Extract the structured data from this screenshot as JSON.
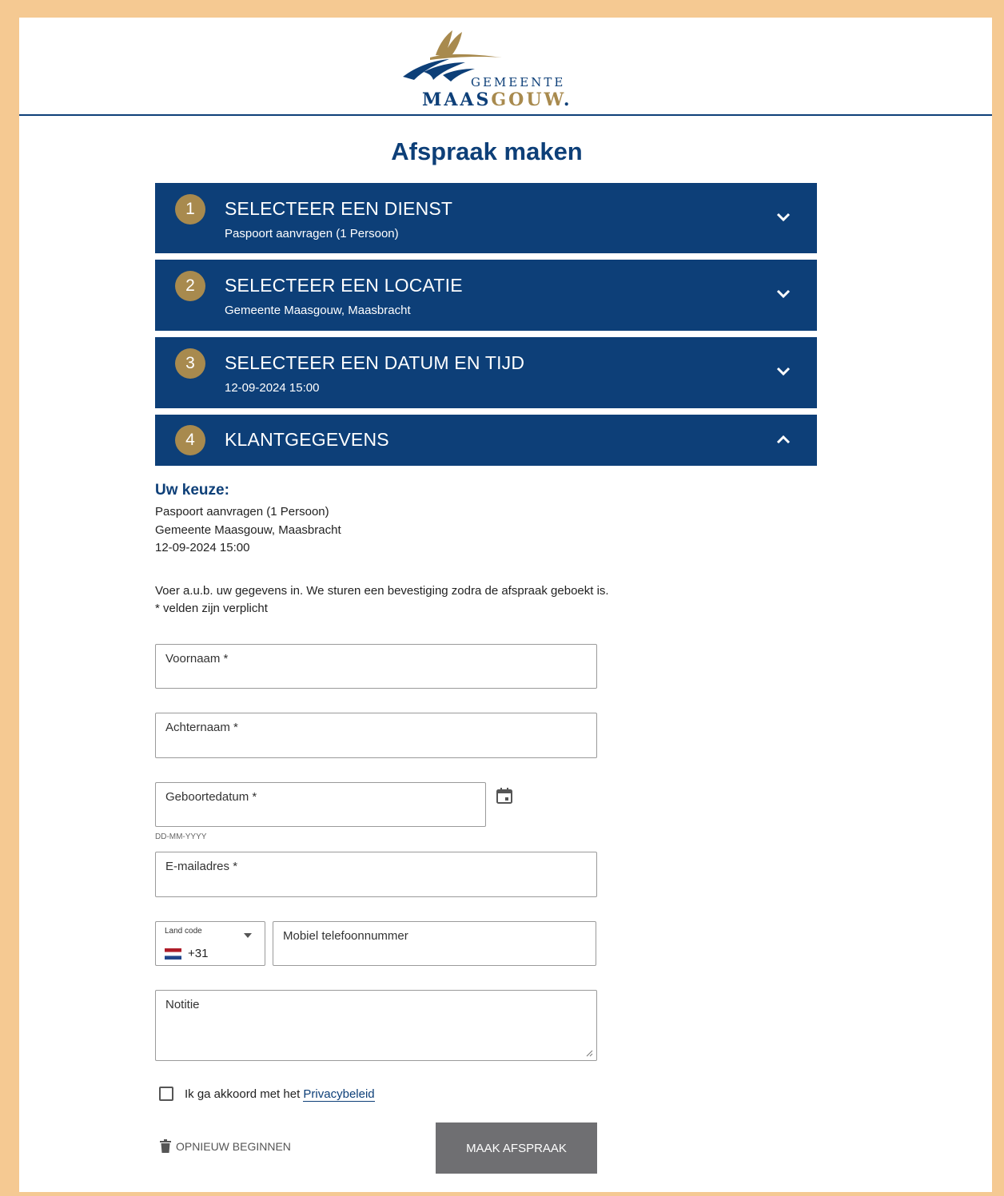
{
  "logo": {
    "line1": "GEMEENTE",
    "line2_a": "MAAS",
    "line2_b": "GOUW",
    "line2_c": "."
  },
  "page_title": "Afspraak maken",
  "steps": [
    {
      "num": "1",
      "title": "SELECTEER EEN DIENST",
      "sub": "Paspoort aanvragen (1 Persoon)",
      "expanded": false
    },
    {
      "num": "2",
      "title": "SELECTEER EEN LOCATIE",
      "sub": "Gemeente Maasgouw, Maasbracht",
      "expanded": false
    },
    {
      "num": "3",
      "title": "SELECTEER EEN DATUM EN TIJD",
      "sub": "12-09-2024 15:00",
      "expanded": false
    },
    {
      "num": "4",
      "title": "KLANTGEGEVENS",
      "sub": "",
      "expanded": true
    }
  ],
  "choice": {
    "title": "Uw keuze:",
    "lines": [
      "Paspoort aanvragen (1 Persoon)",
      "Gemeente Maasgouw, Maasbracht",
      "12-09-2024 15:00"
    ]
  },
  "info": {
    "line1": "Voer a.u.b. uw gegevens in. We sturen een bevestiging zodra de afspraak geboekt is.",
    "line2": "* velden zijn verplicht"
  },
  "fields": {
    "firstname": "Voornaam *",
    "lastname": "Achternaam *",
    "birthdate": "Geboortedatum *",
    "birthdate_hint": "DD-MM-YYYY",
    "email": "E-mailadres *",
    "land_code_label": "Land code",
    "land_code_value": "+31",
    "mobile": "Mobiel telefoonnummer",
    "note": "Notitie"
  },
  "consent": {
    "text": "Ik ga akkoord met het ",
    "link": "Privacybeleid"
  },
  "actions": {
    "restart": "OPNIEUW BEGINNEN",
    "submit": "MAAK AFSPRAAK"
  },
  "colors": {
    "primary": "#0d3f78",
    "gold": "#a88a4e",
    "frame": "#f5c992",
    "button_disabled": "#6f6f72"
  }
}
